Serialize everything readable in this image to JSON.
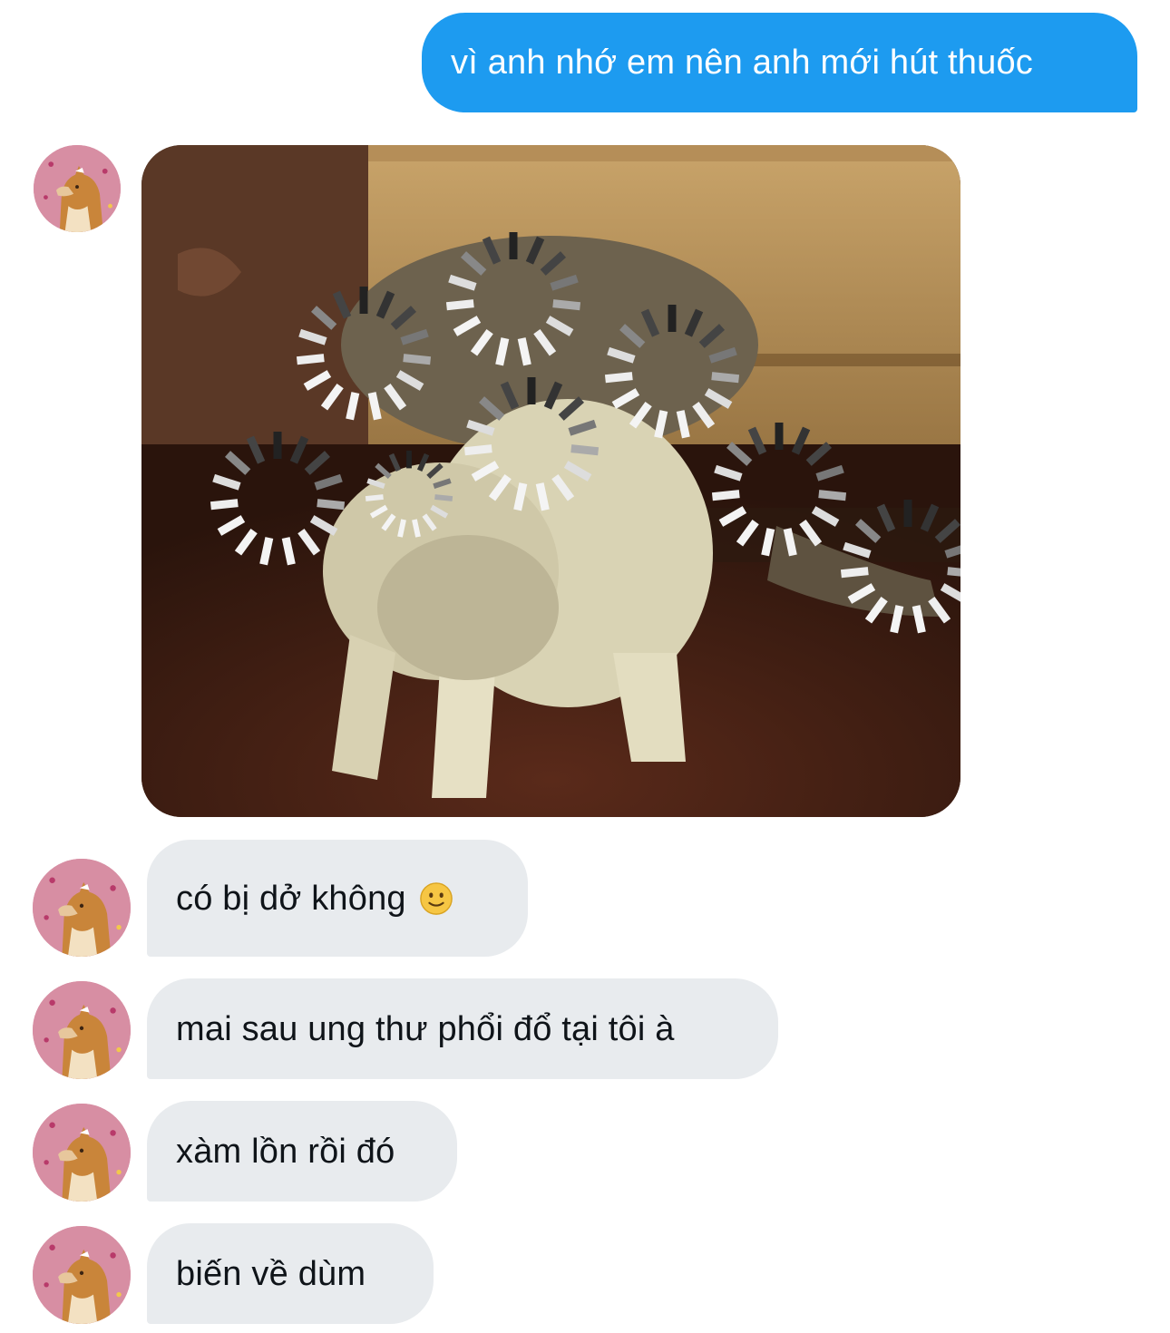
{
  "conversation": {
    "outgoing": [
      {
        "text": "vì anh nhớ em nên anh mới hút thuốc"
      }
    ],
    "incoming_image": {
      "description_icon": "loading-spinner-eyes-cat-meme"
    },
    "incoming": [
      {
        "text": "có bị dở không",
        "emoji": "slightly-smiling-face-emoji"
      },
      {
        "text": "mai sau ung thư phổi đổ tại tôi à"
      },
      {
        "text": "xàm lồn rồi đó"
      },
      {
        "text": "biến về dùm"
      }
    ]
  },
  "colors": {
    "outgoing_bubble": "#1d9bf0",
    "incoming_bubble": "#e8ebee",
    "background": "#ffffff",
    "avatar_background": "#d78ea3"
  }
}
